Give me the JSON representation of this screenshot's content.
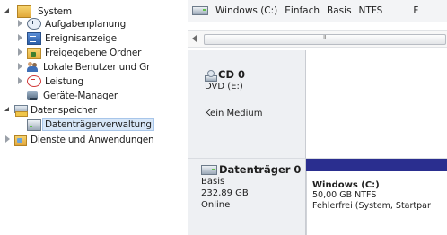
{
  "tree": {
    "items": [
      {
        "label": "System"
      },
      {
        "label": "Aufgabenplanung"
      },
      {
        "label": "Ereignisanzeige"
      },
      {
        "label": "Freigegebene Ordner"
      },
      {
        "label": "Lokale Benutzer und Gr"
      },
      {
        "label": "Leistung"
      },
      {
        "label": "Geräte-Manager"
      },
      {
        "label": "Datenspeicher"
      },
      {
        "label": "Datenträgerverwaltung"
      },
      {
        "label": "Dienste und Anwendungen"
      }
    ]
  },
  "volume_list": {
    "columns": [
      "Windows (C:)",
      "Einfach",
      "Basis",
      "NTFS",
      "F"
    ],
    "scrollbar_grip": "Ⅱ"
  },
  "cd": {
    "title": "CD 0",
    "type": "DVD (E:)",
    "status": "Kein Medium"
  },
  "disk0": {
    "title": "Datenträger 0",
    "type": "Basis",
    "size": "232,89 GB",
    "status": "Online",
    "partition": {
      "name": "Windows  (C:)",
      "size_fs": "50,00 GB NTFS",
      "status": "Fehlerfrei (System, Startpar"
    }
  },
  "colors": {
    "partition_bar": "#2a2e8f",
    "selection": "#d7e6f7"
  }
}
